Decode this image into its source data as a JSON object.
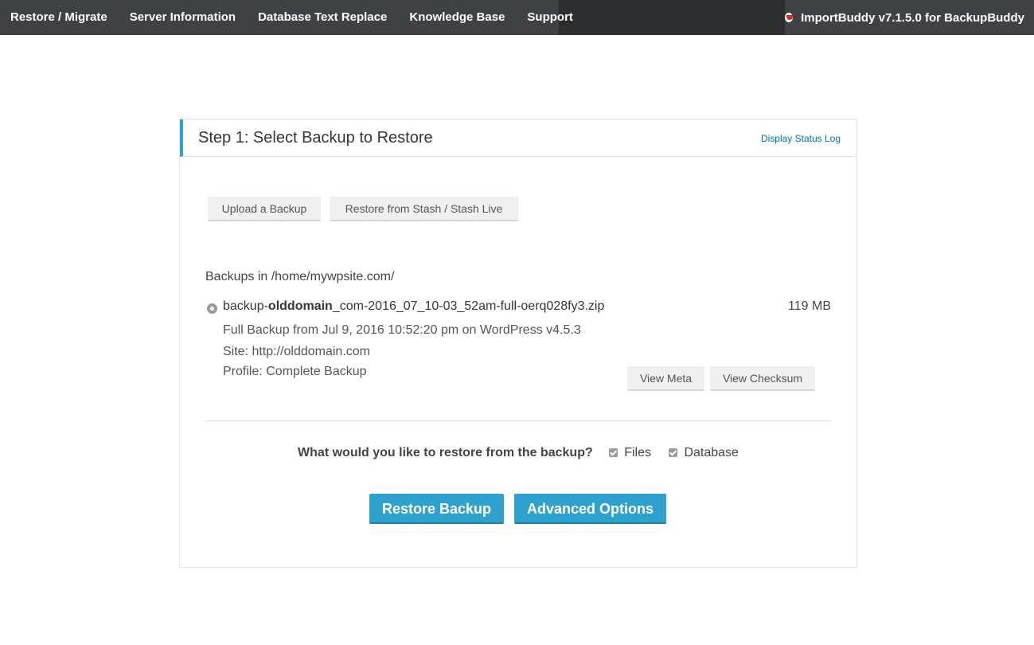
{
  "topbar": {
    "nav": [
      {
        "label": "Restore / Migrate"
      },
      {
        "label": "Server Information"
      },
      {
        "label": "Database Text Replace"
      },
      {
        "label": "Knowledge Base"
      },
      {
        "label": "Support"
      }
    ],
    "brand": "ImportBuddy v7.1.5.0 for BackupBuddy"
  },
  "panel": {
    "title": "Step 1: Select Backup to Restore",
    "status_link": "Display Status Log",
    "upload_label": "Upload a Backup",
    "stash_label": "Restore from Stash / Stash Live",
    "backups_label": "Backups in /home/mywpsite.com/",
    "backup": {
      "filename_prefix": "backup-",
      "filename_domain": "olddomain",
      "filename_suffix": "_com-2016_07_10-03_52am-full-oerq028fy3.zip",
      "size": "119 MB",
      "description": "Full Backup from Jul 9, 2016 10:52:20 pm on WordPress v4.5.3",
      "site": "Site: http://olddomain.com",
      "profile": "Profile: Complete Backup",
      "view_meta_label": "View Meta",
      "view_checksum_label": "View Checksum"
    },
    "restore_question": "What would you like to restore from the backup?",
    "files_label": "Files",
    "database_label": "Database",
    "restore_button": "Restore Backup",
    "advanced_button": "Advanced Options"
  },
  "colors": {
    "accent": "#2ea2cc",
    "topbar": "#3f4144",
    "link": "#0073aa"
  },
  "icons": {
    "brand": "backupbuddy-logo-icon",
    "radio": "radio-selected-icon",
    "checkbox": "checkbox-checked-icon"
  }
}
